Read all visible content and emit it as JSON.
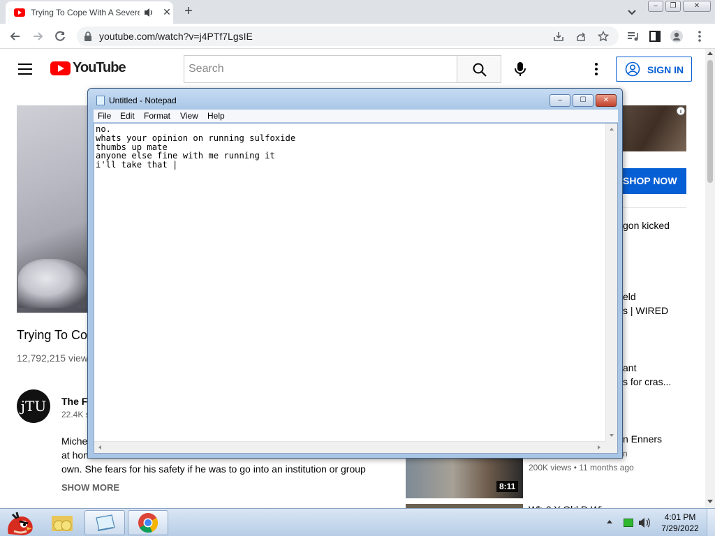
{
  "browser": {
    "tab_title": "Trying To Cope With A Severe",
    "tab_close": "✕",
    "new_tab": "+",
    "url": "youtube.com/watch?v=j4PTf7LgsIE",
    "window_minimize": "–",
    "window_restore": "❐",
    "window_close": "✕"
  },
  "youtube": {
    "logo_text": "YouTube",
    "search_placeholder": "Search",
    "sign_in": "SIGN IN",
    "video_title": "Trying To Co",
    "views": "12,792,215 view",
    "channel_avatar": "jTU",
    "channel_name": "The F",
    "subscribers": "22.4K s",
    "description_lines": [
      "Miche",
      "at hon",
      "own. She fears for his safety if he was to go into an institution or group"
    ],
    "show_more": "SHOW MORE",
    "ad_shop_now": "SHOP NOW",
    "recommendations": [
      {
        "title": "gon kicked"
      },
      {
        "title": "eld"
      },
      {
        "title": "s | WIRED"
      },
      {
        "title": "ant"
      },
      {
        "title": "s for cras..."
      },
      {
        "title": "n Enners"
      }
    ],
    "rec_meta_fragment": "n",
    "rec_duration": "8:11",
    "rec_meta": "200K views • 11 months ago",
    "rec_title_cut": "Wh  0  Y   Old D   Wi"
  },
  "notepad": {
    "title": "Untitled - Notepad",
    "minimize": "–",
    "maximize": "☐",
    "close": "✕",
    "menu": [
      "File",
      "Edit",
      "Format",
      "View",
      "Help"
    ],
    "text": "no.\nwhats your opinion on running sulfoxide\nthumbs up mate\nanyone else fine with me running it\ni'll take that |"
  },
  "taskbar": {
    "time": "4:01 PM",
    "date": "7/29/2022"
  },
  "colors": {
    "youtube_red": "#ff0000",
    "youtube_blue": "#065fd4",
    "notepad_frame": "#a9c6e6",
    "taskbar": "#c7d9ee"
  }
}
